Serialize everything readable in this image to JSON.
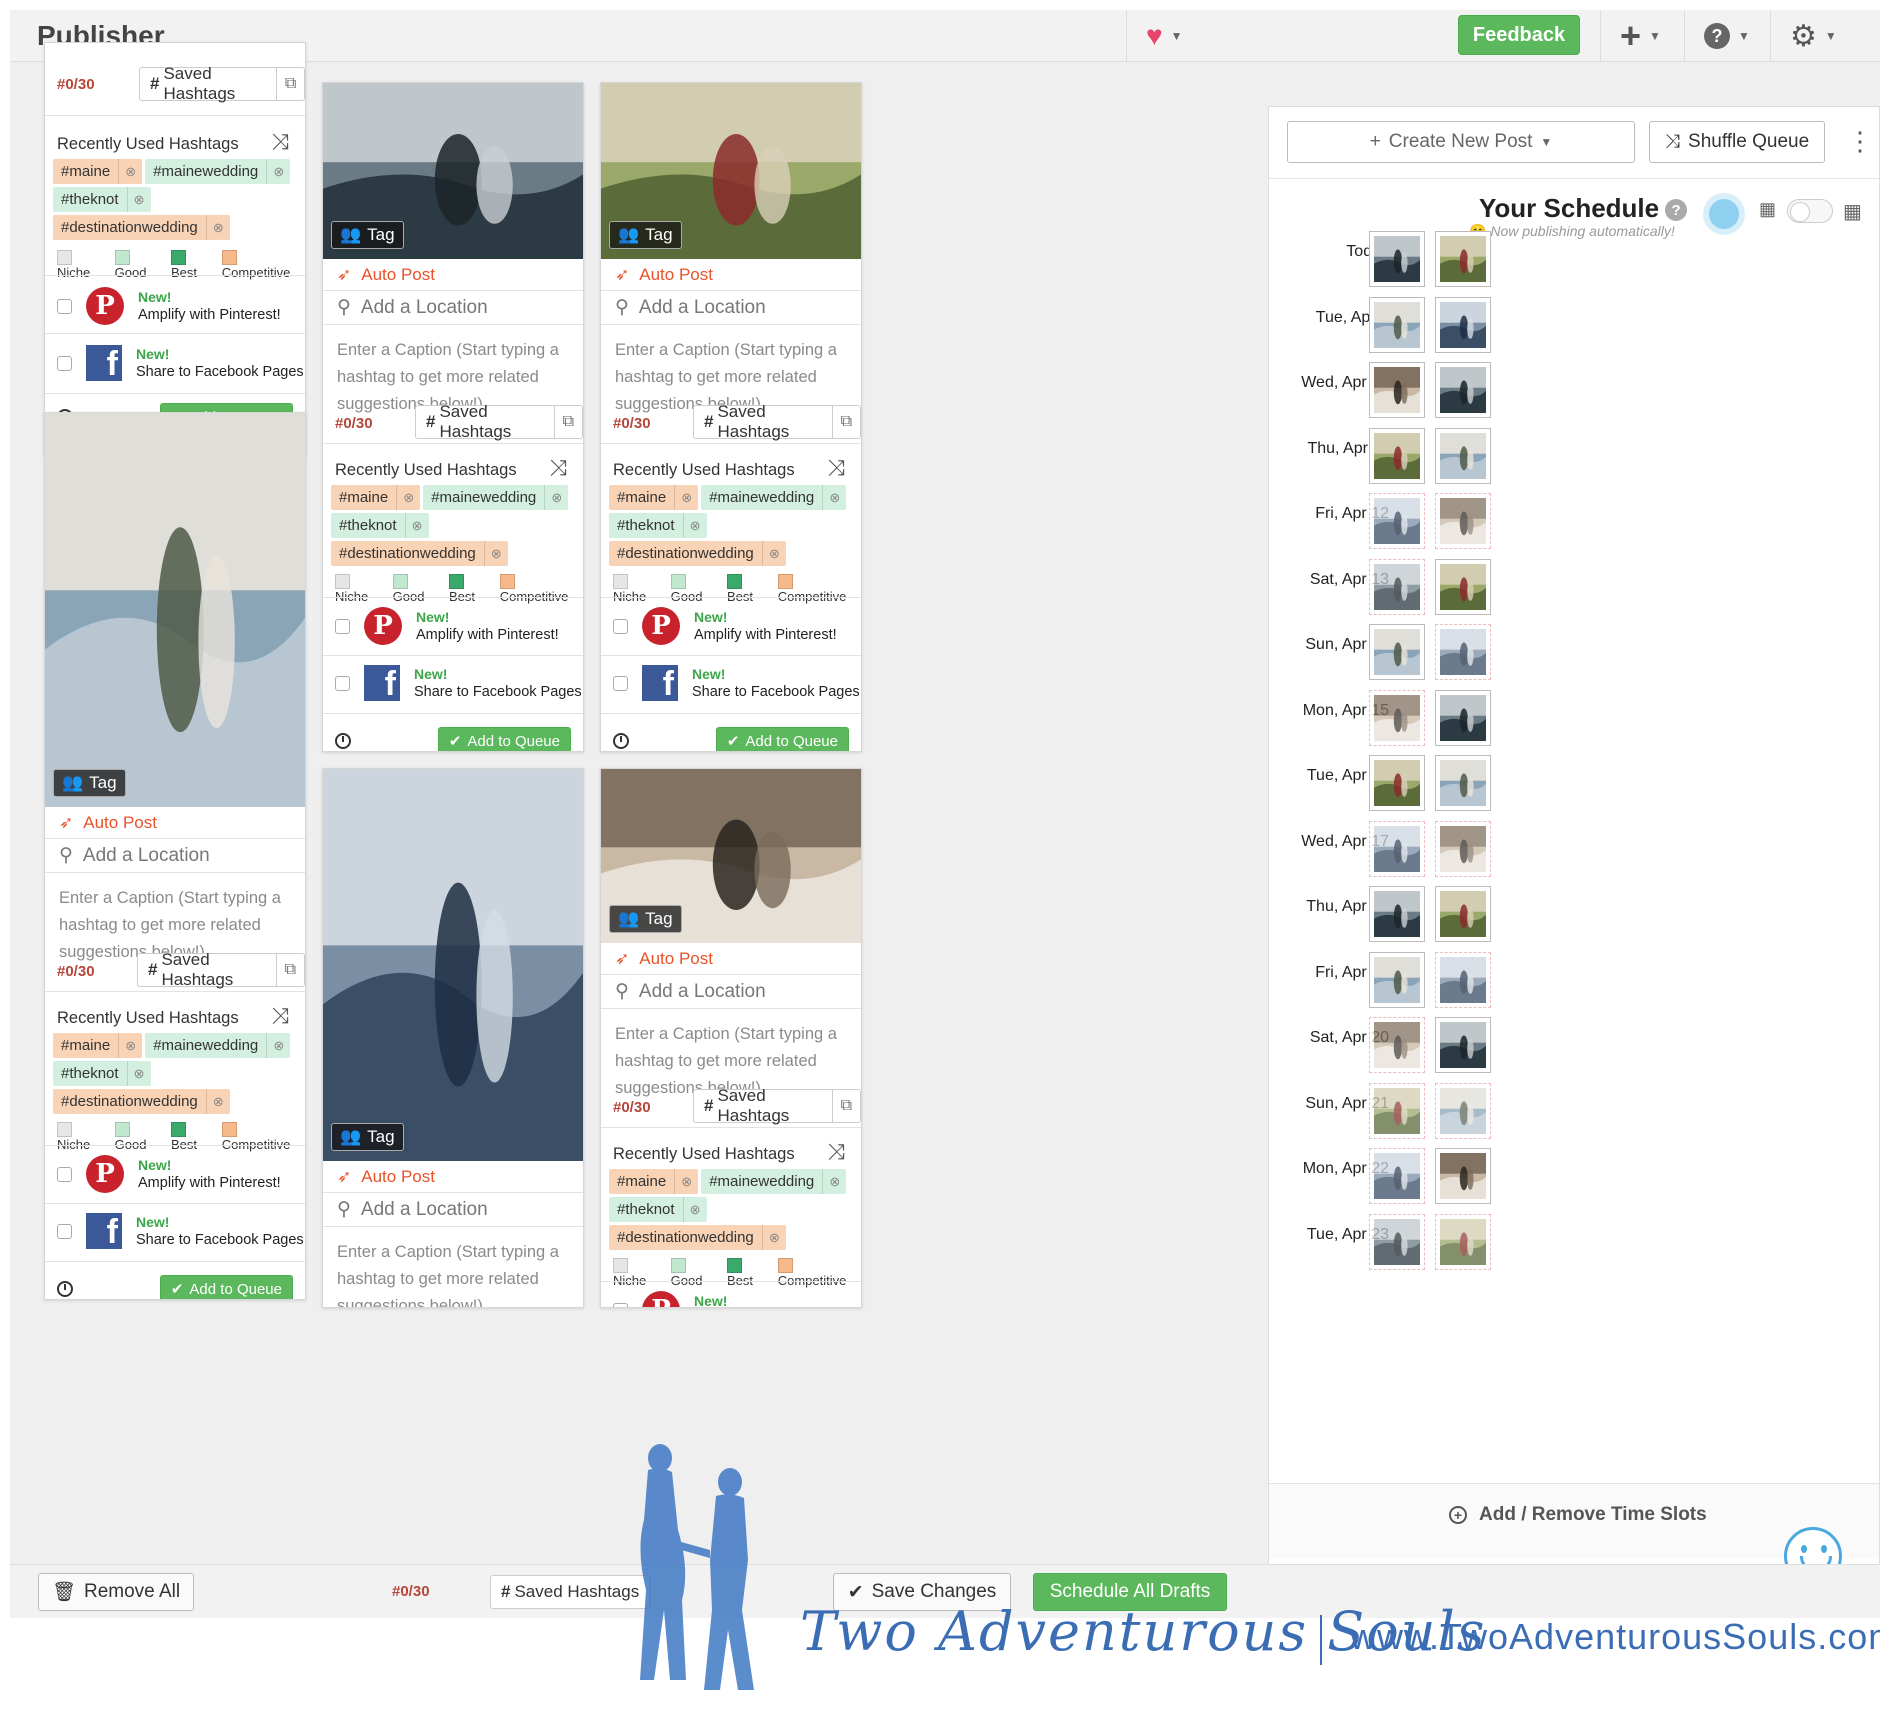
{
  "app": {
    "title": "Publisher",
    "feedback_label": "Feedback",
    "icons": [
      "heart-icon",
      "plus-icon",
      "help-icon",
      "gear-icon"
    ],
    "accent": "#5cb85c"
  },
  "card_common": {
    "tag_label": "Tag",
    "auto_post": "Auto Post",
    "add_location": "Add a Location",
    "caption_placeholder": "Enter a Caption (Start typing a hashtag to get more related suggestions below!)",
    "hashtag_count": "#0/30",
    "saved_hashtags": "Saved Hashtags",
    "recently_used": "Recently Used Hashtags",
    "hashtags": [
      {
        "tag": "#maine",
        "level": "competitive"
      },
      {
        "tag": "#mainewedding",
        "level": "good"
      },
      {
        "tag": "#theknot",
        "level": "good"
      },
      {
        "tag": "#destinationwedding",
        "level": "competitive"
      }
    ],
    "legend": [
      "Niche",
      "Good",
      "Best",
      "Competitive"
    ],
    "legend_colors": [
      "#e6e6e6",
      "#bfe8cf",
      "#3aaa6c",
      "#f7b98a"
    ],
    "pinterest_new": "New!",
    "pinterest_desc": "Amplify with Pinterest!",
    "facebook_new": "New!",
    "facebook_desc": "Share to Facebook Pages",
    "add_to_queue": "Add to Queue"
  },
  "schedule": {
    "create_new_post": "Create New Post",
    "shuffle_queue": "Shuffle Queue",
    "title": "Your Schedule",
    "subtitle": "Now publishing automatically!",
    "days": [
      "Today",
      "Tue, Apr 9",
      "Wed, Apr 10",
      "Thu, Apr 11",
      "Fri, Apr 12",
      "Sat, Apr 13",
      "Sun, Apr 14",
      "Mon, Apr 15",
      "Tue, Apr 16",
      "Wed, Apr 17",
      "Thu, Apr 18",
      "Fri, Apr 19",
      "Sat, Apr 20",
      "Sun, Apr 21",
      "Mon, Apr 22",
      "Tue, Apr 23"
    ],
    "add_remove_slots": "Add / Remove Time Slots"
  },
  "bottom": {
    "remove_all": "Remove All",
    "save_changes": "Save Changes",
    "schedule_all": "Schedule All Drafts"
  },
  "watermark": {
    "script": "Two Adventurous Souls",
    "url": "www.TwoAdventurousSouls.com"
  }
}
